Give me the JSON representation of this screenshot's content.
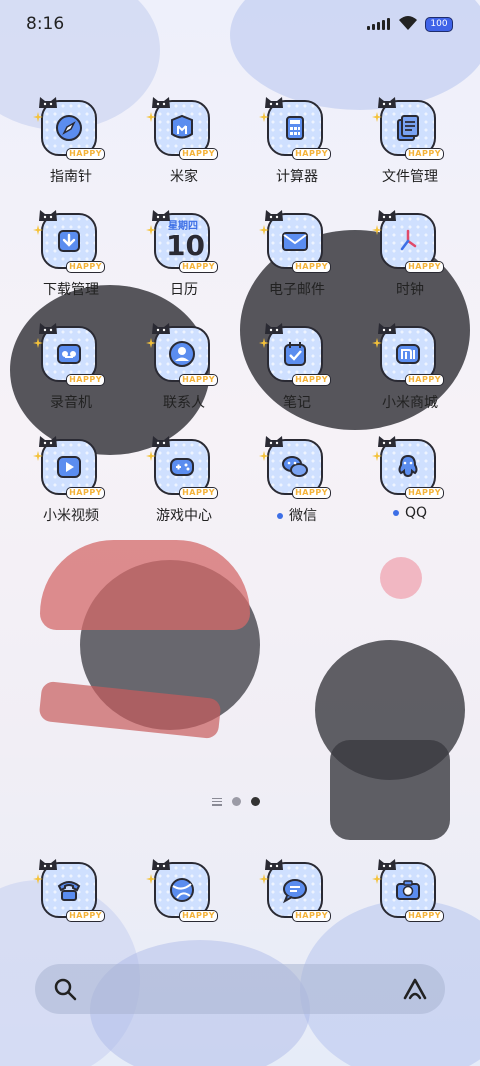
{
  "status_bar": {
    "time": "8:16",
    "battery": "100"
  },
  "apps": [
    {
      "name": "compass",
      "label": "指南针"
    },
    {
      "name": "mi-home",
      "label": "米家"
    },
    {
      "name": "calculator",
      "label": "计算器"
    },
    {
      "name": "file-manager",
      "label": "文件管理"
    },
    {
      "name": "downloads",
      "label": "下载管理"
    },
    {
      "name": "calendar",
      "label": "日历",
      "weekday": "星期四",
      "day": "10"
    },
    {
      "name": "email",
      "label": "电子邮件"
    },
    {
      "name": "clock",
      "label": "时钟"
    },
    {
      "name": "recorder",
      "label": "录音机"
    },
    {
      "name": "contacts",
      "label": "联系人"
    },
    {
      "name": "notes",
      "label": "笔记"
    },
    {
      "name": "mi-store",
      "label": "小米商城"
    },
    {
      "name": "mi-video",
      "label": "小米视频"
    },
    {
      "name": "game-center",
      "label": "游戏中心"
    },
    {
      "name": "wechat",
      "label": "微信"
    },
    {
      "name": "qq",
      "label": "QQ"
    }
  ],
  "badge_text": "HAPPY",
  "dock": [
    {
      "name": "phone"
    },
    {
      "name": "browser"
    },
    {
      "name": "messages"
    },
    {
      "name": "camera"
    }
  ],
  "colors": {
    "accent": "#3d6fe6",
    "tile": "#cfe0ff",
    "outline": "#2a2a33",
    "happy": "#f4b33a"
  }
}
